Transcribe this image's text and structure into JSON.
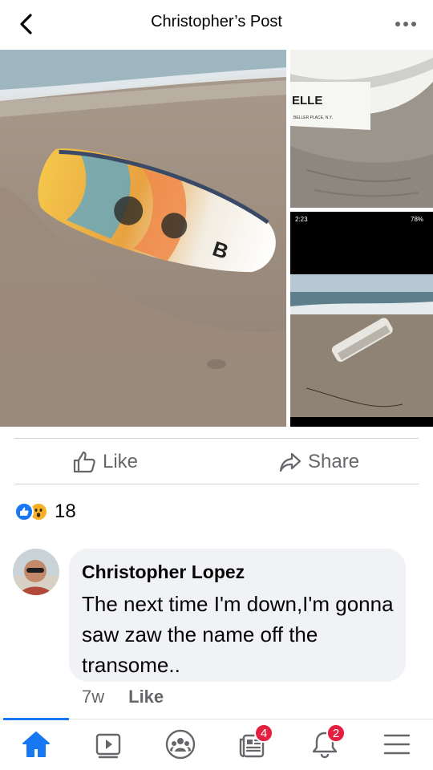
{
  "header": {
    "title": "Christopher’s Post",
    "back_icon": "chevron-left-icon",
    "more_icon": "more-horizontal-icon"
  },
  "photos": {
    "boat_name_text": "ELLE",
    "boat_place_text": "BELLER PLACE, N.Y.",
    "statusbar_time": "2:23",
    "statusbar_battery": "78%"
  },
  "actions": {
    "like_label": "Like",
    "share_label": "Share"
  },
  "reactions": {
    "count": "18",
    "types": [
      "like",
      "wow"
    ]
  },
  "comment": {
    "author": "Christopher Lopez",
    "text": "The next time I'm down,I'm gonna saw zaw the name off the transome..",
    "time": "7w",
    "like_label": "Like"
  },
  "nav": {
    "items": [
      "home-icon",
      "video-icon",
      "groups-icon",
      "news-icon",
      "notifications-icon",
      "menu-icon"
    ],
    "news_badge": "4",
    "notifications_badge": "2"
  },
  "colors": {
    "accent": "#1877f2",
    "badge": "#e41e3f",
    "secondary_text": "#65676b",
    "bubble": "#f0f2f5"
  }
}
